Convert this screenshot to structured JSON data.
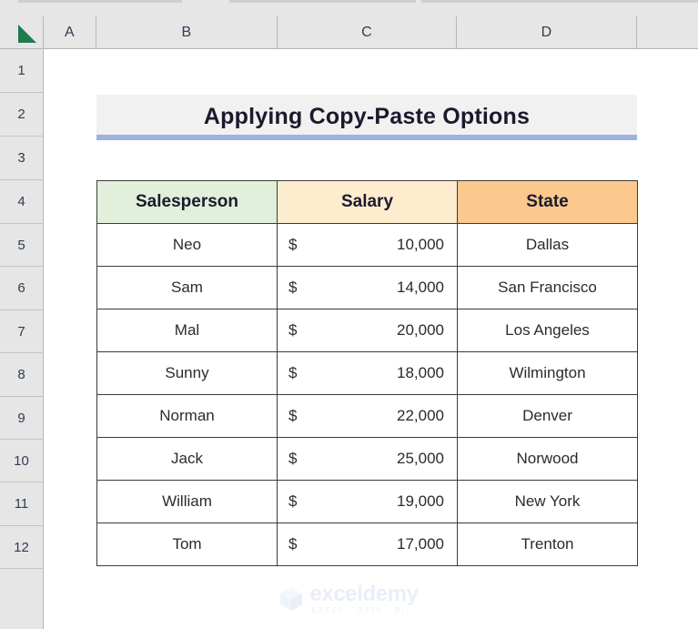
{
  "app": {
    "type": "spreadsheet",
    "column_headers": [
      "A",
      "B",
      "C",
      "D"
    ],
    "row_headers": [
      "1",
      "2",
      "3",
      "4",
      "5",
      "6",
      "7",
      "8",
      "9",
      "10",
      "11",
      "12"
    ],
    "select_all_icon": "select-all-triangle-icon"
  },
  "title": {
    "text": "Applying Copy-Paste Options",
    "underline_color": "#9cb3e0",
    "background_color": "#f1f1f1"
  },
  "table": {
    "headers": [
      {
        "label": "Salesperson",
        "color": "#e2efda"
      },
      {
        "label": "Salary",
        "color": "#fdeccd"
      },
      {
        "label": "State",
        "color": "#fbc88d"
      }
    ],
    "currency_symbol": "$",
    "rows": [
      {
        "salesperson": "Neo",
        "salary": "10,000",
        "state": "Dallas"
      },
      {
        "salesperson": "Sam",
        "salary": "14,000",
        "state": "San Francisco"
      },
      {
        "salesperson": "Mal",
        "salary": "20,000",
        "state": "Los Angeles"
      },
      {
        "salesperson": "Sunny",
        "salary": "18,000",
        "state": "Wilmington"
      },
      {
        "salesperson": "Norman",
        "salary": "22,000",
        "state": "Denver"
      },
      {
        "salesperson": "Jack",
        "salary": "25,000",
        "state": "Norwood"
      },
      {
        "salesperson": "William",
        "salary": "19,000",
        "state": "New York"
      },
      {
        "salesperson": "Tom",
        "salary": "17,000",
        "state": "Trenton"
      }
    ]
  },
  "watermark": {
    "name": "exceldemy",
    "tagline": "EXCEL · DATA · BI",
    "icon": "cube-logo-icon"
  }
}
